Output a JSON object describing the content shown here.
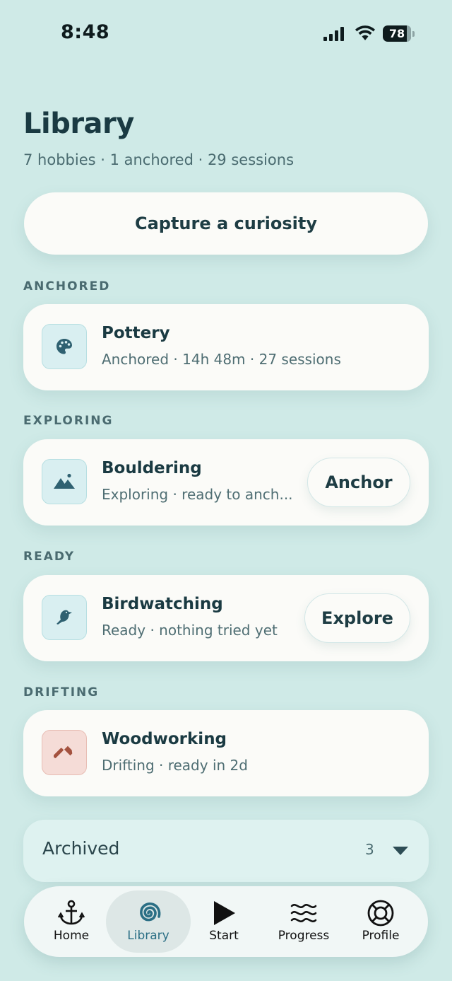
{
  "status_bar": {
    "time": "8:48",
    "battery": "78"
  },
  "header": {
    "title": "Library",
    "subtitle": "7 hobbies · 1 anchored · 29 sessions"
  },
  "capture_button": "Capture a curiosity",
  "sections": {
    "anchored": "ANCHORED",
    "exploring": "EXPLORING",
    "ready": "READY",
    "drifting": "DRIFTING"
  },
  "hobbies": {
    "pottery": {
      "name": "Pottery",
      "meta": "Anchored · 14h 48m · 27 sessions",
      "icon": "palette-icon"
    },
    "bouldering": {
      "name": "Bouldering",
      "meta": "Exploring · ready to anch...",
      "icon": "mountain-icon",
      "action": "Anchor"
    },
    "birdwatching": {
      "name": "Birdwatching",
      "meta": "Ready · nothing tried yet",
      "icon": "bird-icon",
      "action": "Explore"
    },
    "woodworking": {
      "name": "Woodworking",
      "meta": "Drifting · ready in 2d",
      "icon": "hammer-icon"
    }
  },
  "archived": {
    "label": "Archived",
    "count": "3"
  },
  "tabs": [
    {
      "label": "Home",
      "icon": "anchor-icon"
    },
    {
      "label": "Library",
      "icon": "spiral-icon",
      "active": true
    },
    {
      "label": "Start",
      "icon": "play-icon"
    },
    {
      "label": "Progress",
      "icon": "waves-icon"
    },
    {
      "label": "Profile",
      "icon": "lifebuoy-icon"
    }
  ],
  "colors": {
    "background": "#cfeae7",
    "card": "#fbfbf8",
    "text": "#1e3d44",
    "accent": "#2b6f85",
    "drifting_icon_bg": "#f5dcd7"
  }
}
